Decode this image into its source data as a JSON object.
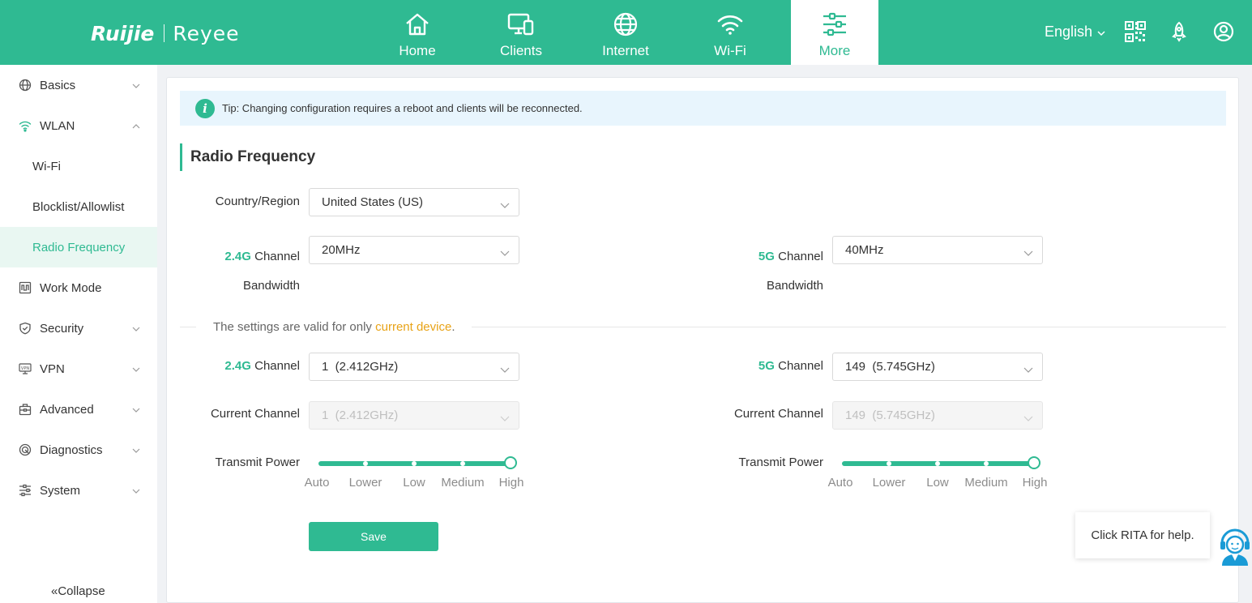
{
  "brand": {
    "logo_left": "Ruijie",
    "logo_right": "Reyee"
  },
  "topnav": [
    {
      "label": "Home",
      "icon": "home-icon"
    },
    {
      "label": "Clients",
      "icon": "devices-icon"
    },
    {
      "label": "Internet",
      "icon": "globe-icon"
    },
    {
      "label": "Wi-Fi",
      "icon": "wifi-icon"
    },
    {
      "label": "More",
      "icon": "sliders-icon",
      "active": true
    }
  ],
  "topright": {
    "language": "English",
    "icons": [
      "qrcode-icon",
      "rocket-icon",
      "user-icon"
    ]
  },
  "sidebar": {
    "items": [
      {
        "label": "Basics",
        "icon": "globe-icon",
        "expanded": false
      },
      {
        "label": "WLAN",
        "icon": "wifi-icon",
        "expanded": true
      },
      {
        "label": "Wi-Fi",
        "sub": true
      },
      {
        "label": "Blocklist/Allowlist",
        "sub": true
      },
      {
        "label": "Radio Frequency",
        "sub": true,
        "active": true
      },
      {
        "label": "Work Mode",
        "icon": "workmode-icon"
      },
      {
        "label": "Security",
        "icon": "shield-icon",
        "expanded": false
      },
      {
        "label": "VPN",
        "icon": "vpn-icon",
        "expanded": false
      },
      {
        "label": "Advanced",
        "icon": "toolbox-icon",
        "expanded": false
      },
      {
        "label": "Diagnostics",
        "icon": "diagnostics-icon",
        "expanded": false
      },
      {
        "label": "System",
        "icon": "system-icon",
        "expanded": false
      }
    ],
    "collapse_label": "Collapse"
  },
  "main": {
    "tip": "Tip: Changing configuration requires a reboot and clients will be reconnected.",
    "title": "Radio Frequency",
    "country_label": "Country/Region",
    "country_value": "United States (US)",
    "band24": {
      "tag": "2.4G",
      "bw_label_a": "Channel",
      "bw_label_b": "Bandwidth",
      "bw_value": "20MHz",
      "channel_label": "Channel",
      "channel_value": "1  (2.412GHz)",
      "current_label": "Current Channel",
      "current_value": "1  (2.412GHz)",
      "power_label": "Transmit Power",
      "power_level": "High"
    },
    "band5": {
      "tag": "5G",
      "bw_label_a": "Channel",
      "bw_label_b": "Bandwidth",
      "bw_value": "40MHz",
      "channel_label": "Channel",
      "channel_value": "149  (5.745GHz)",
      "current_label": "Current Channel",
      "current_value": "149  (5.745GHz)",
      "power_label": "Transmit Power",
      "power_level": "High"
    },
    "power_levels": [
      "Auto",
      "Lower",
      "Low",
      "Medium",
      "High"
    ],
    "divider_text_a": "The settings are valid for only ",
    "divider_text_b": "current device",
    "divider_text_c": ".",
    "save_label": "Save"
  },
  "rita": {
    "help_text": "Click RITA for help."
  },
  "colors": {
    "accent": "#2fba92",
    "highlight": "#e8a317",
    "tip_bg": "#e8f5fd"
  }
}
